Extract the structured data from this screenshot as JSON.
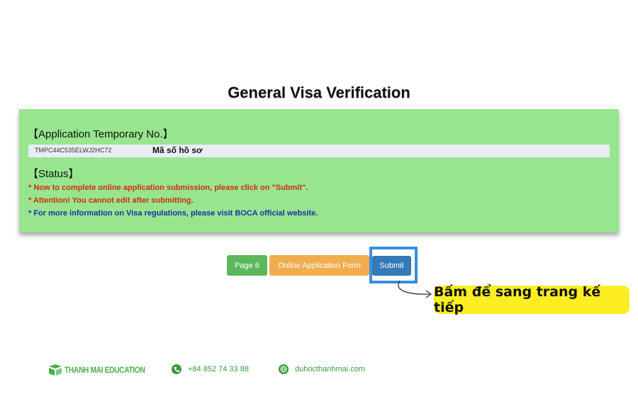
{
  "page": {
    "title": "General Visa Verification"
  },
  "application": {
    "heading": "【Application Temporary No.】",
    "number": "TMPC44C535ELWJ2HC72",
    "annotation": "Mã số hồ sơ"
  },
  "status": {
    "heading": "【Status】",
    "lines": [
      "* Now to complete online application submission, please click on \"Submit\".",
      "* Attention!  You cannot edit after submitting.",
      "* For more information on Visa regulations, please visit BOCA official website."
    ]
  },
  "buttons": {
    "page": "Page 6",
    "form": "Online Application Form",
    "submit": "Submit"
  },
  "callout": {
    "text": "Bấm để sang trang kế tiếp"
  },
  "footer": {
    "brand": "THANH MAI EDUCATION",
    "phone": "+84 852 74 33 88",
    "website": "duhocthanhmai.com"
  },
  "colors": {
    "panel_bg": "#97e68e",
    "warning_text": "#d42a0e",
    "info_text": "#1d2fa8",
    "btn_page": "#5cb85c",
    "btn_form": "#f0ad4e",
    "btn_submit": "#337ab7",
    "highlight": "#3a8ee0",
    "callout_bg": "#fcee23",
    "brand_green": "#3a9a3d"
  },
  "icons": {
    "brand": "book-logo-icon",
    "phone": "phone-icon",
    "website": "globe-icon",
    "callout": "curved-arrow-icon"
  }
}
